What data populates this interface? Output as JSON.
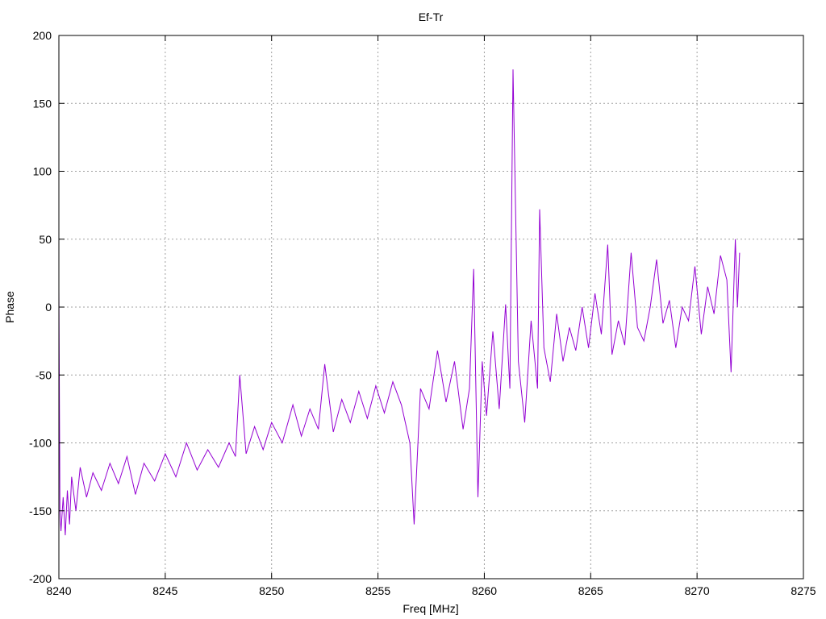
{
  "chart_data": {
    "type": "line",
    "title": "Ef-Tr",
    "xlabel": "Freq [MHz]",
    "ylabel": "Phase",
    "xlim": [
      8240,
      8275
    ],
    "ylim": [
      -200,
      200
    ],
    "xticks": [
      8240,
      8245,
      8250,
      8255,
      8260,
      8265,
      8270,
      8275
    ],
    "yticks": [
      -200,
      -150,
      -100,
      -50,
      0,
      50,
      100,
      150,
      200
    ],
    "grid": true,
    "legend": "none",
    "series": [
      {
        "color": "#9400d3",
        "x": [
          8240.0,
          8240.05,
          8240.1,
          8240.2,
          8240.3,
          8240.4,
          8240.5,
          8240.6,
          8240.8,
          8241.0,
          8241.3,
          8241.6,
          8242.0,
          8242.4,
          8242.8,
          8243.2,
          8243.6,
          8244.0,
          8244.5,
          8245.0,
          8245.5,
          8246.0,
          8246.5,
          8247.0,
          8247.5,
          8248.0,
          8248.3,
          8248.5,
          8248.8,
          8249.2,
          8249.6,
          8250.0,
          8250.5,
          8251.0,
          8251.4,
          8251.8,
          8252.2,
          8252.5,
          8252.9,
          8253.3,
          8253.7,
          8254.1,
          8254.5,
          8254.9,
          8255.3,
          8255.7,
          8256.1,
          8256.5,
          8256.7,
          8257.0,
          8257.4,
          8257.8,
          8258.2,
          8258.6,
          8259.0,
          8259.3,
          8259.5,
          8259.7,
          8259.9,
          8260.1,
          8260.4,
          8260.7,
          8261.0,
          8261.2,
          8261.35,
          8261.6,
          8261.9,
          8262.2,
          8262.5,
          8262.6,
          8262.8,
          8263.1,
          8263.4,
          8263.7,
          8264.0,
          8264.3,
          8264.6,
          8264.9,
          8265.2,
          8265.5,
          8265.8,
          8266.0,
          8266.3,
          8266.6,
          8266.9,
          8267.2,
          8267.5,
          8267.8,
          8268.1,
          8268.4,
          8268.7,
          8269.0,
          8269.3,
          8269.6,
          8269.9,
          8270.2,
          8270.5,
          8270.8,
          8271.1,
          8271.4,
          8271.6,
          8271.8,
          8271.9,
          8272.0
        ],
        "y": [
          14,
          -150,
          -165,
          -140,
          -168,
          -135,
          -160,
          -125,
          -150,
          -118,
          -140,
          -122,
          -135,
          -115,
          -130,
          -110,
          -138,
          -115,
          -128,
          -108,
          -125,
          -100,
          -120,
          -105,
          -118,
          -100,
          -110,
          -50,
          -108,
          -88,
          -105,
          -85,
          -100,
          -72,
          -95,
          -75,
          -90,
          -42,
          -92,
          -68,
          -85,
          -62,
          -82,
          -58,
          -78,
          -55,
          -72,
          -100,
          -160,
          -60,
          -75,
          -32,
          -70,
          -40,
          -90,
          -60,
          28,
          -140,
          -40,
          -80,
          -18,
          -75,
          2,
          -60,
          175,
          -40,
          -85,
          -10,
          -60,
          72,
          -30,
          -55,
          -5,
          -40,
          -15,
          -32,
          0,
          -30,
          10,
          -20,
          46,
          -35,
          -10,
          -28,
          40,
          -15,
          -25,
          0,
          35,
          -12,
          5,
          -30,
          0,
          -10,
          30,
          -20,
          15,
          -5,
          38,
          20,
          -48,
          50,
          0,
          40
        ]
      }
    ]
  }
}
